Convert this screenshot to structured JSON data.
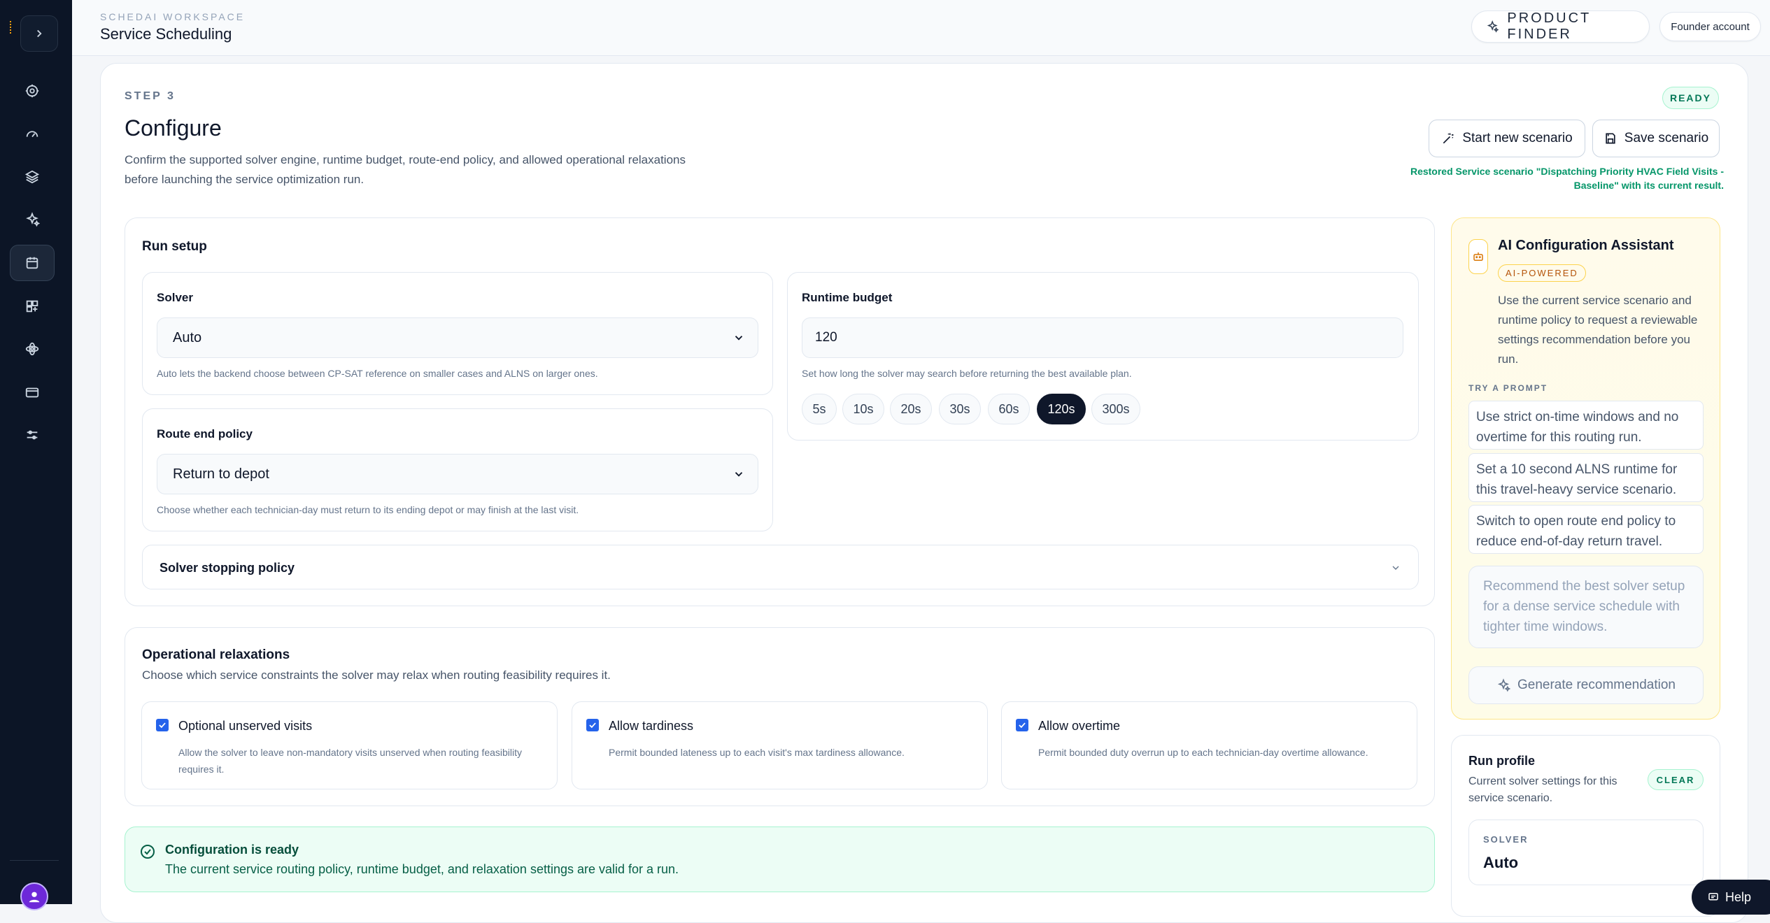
{
  "header": {
    "workspace": "SCHEDAI WORKSPACE",
    "title": "Service Scheduling",
    "product_finder": "PRODUCT FINDER",
    "account": "Founder account"
  },
  "sidebar": {
    "icons": [
      "settings-icon",
      "gauge-icon",
      "layers-icon",
      "sparkles-icon",
      "calendar-icon",
      "grid-plus-icon",
      "atom-icon",
      "credit-card-icon",
      "sliders-icon"
    ],
    "active": "calendar-icon"
  },
  "step": {
    "label": "STEP 3",
    "title": "Configure",
    "description": "Confirm the supported solver engine, runtime budget, route-end policy, and allowed operational relaxations before launching the service optimization run.",
    "status": "READY",
    "start_new": "Start new scenario",
    "save": "Save scenario",
    "restored_msg": "Restored Service scenario \"Dispatching Priority HVAC Field Visits - Baseline\" with its current result."
  },
  "run_setup": {
    "title": "Run setup",
    "solver": {
      "label": "Solver",
      "value": "Auto",
      "hint": "Auto lets the backend choose between CP-SAT reference on smaller cases and ALNS on larger ones."
    },
    "runtime": {
      "label": "Runtime budget",
      "value": "120",
      "hint": "Set how long the solver may search before returning the best available plan.",
      "presets": [
        "5s",
        "10s",
        "20s",
        "30s",
        "60s",
        "120s",
        "300s"
      ],
      "selected": "120s"
    },
    "route_end": {
      "label": "Route end policy",
      "value": "Return to depot",
      "hint": "Choose whether each technician-day must return to its ending depot or may finish at the last visit."
    },
    "stopping": "Solver stopping policy"
  },
  "relaxations": {
    "title": "Operational relaxations",
    "subtitle": "Choose which service constraints the solver may relax when routing feasibility requires it.",
    "items": [
      {
        "title": "Optional unserved visits",
        "desc": "Allow the solver to leave non-mandatory visits unserved when routing feasibility requires it.",
        "checked": true
      },
      {
        "title": "Allow tardiness",
        "desc": "Permit bounded lateness up to each visit's max tardiness allowance.",
        "checked": true
      },
      {
        "title": "Allow overtime",
        "desc": "Permit bounded duty overrun up to each technician-day overtime allowance.",
        "checked": true
      }
    ]
  },
  "status": {
    "title": "Configuration is ready",
    "message": "The current service routing policy, runtime budget, and relaxation settings are valid for a run."
  },
  "ai": {
    "title": "AI Configuration Assistant",
    "badge": "AI-POWERED",
    "description": "Use the current service scenario and runtime policy to request a reviewable settings recommendation before you run.",
    "try_label": "TRY A PROMPT",
    "prompts": [
      "Use strict on-time windows and no overtime for this routing run.",
      "Set a 10 second ALNS runtime for this travel-heavy service scenario.",
      "Switch to open route end policy to reduce end-of-day return travel."
    ],
    "placeholder": "Recommend the best solver setup for a dense service schedule with tighter time windows.",
    "generate": "Generate recommendation"
  },
  "run_profile": {
    "title": "Run profile",
    "description": "Current solver settings for this service scenario.",
    "badge": "CLEAR",
    "solver_key": "SOLVER",
    "solver_value": "Auto"
  },
  "help": "Help"
}
